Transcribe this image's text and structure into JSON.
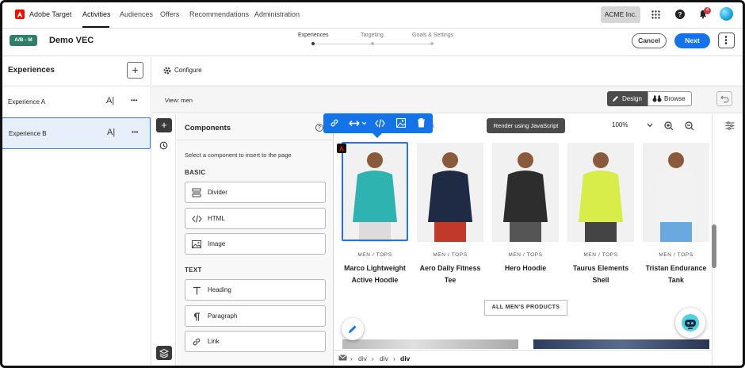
{
  "app": {
    "title": "Adobe Target"
  },
  "topnav": {
    "items": [
      "Activities",
      "Audiences",
      "Offers",
      "Recommendations",
      "Administration"
    ],
    "org": "ACME Inc.",
    "notifications": "4"
  },
  "activity": {
    "badge": "A/B - M",
    "name": "Demo VEC",
    "steps": [
      "Experiences",
      "Targeting",
      "Goals & Settings"
    ],
    "cancel": "Cancel",
    "next": "Next"
  },
  "experiences": {
    "title": "Experiences",
    "add": "+",
    "items": [
      {
        "label": "Experience A"
      },
      {
        "label": "Experience B"
      }
    ],
    "edit_glyph": "A|",
    "more_glyph": "•••"
  },
  "toolbar": {
    "configure": "Configure",
    "view": "View: men",
    "design": "Design",
    "browse": "Browse"
  },
  "components": {
    "title": "Components",
    "help": "?",
    "close": "×",
    "description": "Select a component to insert to the page",
    "basic_label": "BASIC",
    "basic": [
      {
        "label": "Divider",
        "icon": "divider-icon"
      },
      {
        "label": "HTML",
        "icon": "code-icon"
      },
      {
        "label": "Image",
        "icon": "image-icon"
      }
    ],
    "text_label": "TEXT",
    "text": [
      {
        "label": "Heading",
        "icon": "text-heading-icon"
      },
      {
        "label": "Paragraph",
        "icon": "paragraph-icon"
      },
      {
        "label": "Link",
        "icon": "link-icon"
      }
    ]
  },
  "canvas": {
    "tooltip": "Render using JavaScript",
    "zoom": "100%",
    "products": [
      {
        "category": "MEN / TOPS",
        "name_line1": "Marco Lightweight",
        "name_line2": "Active Hoodie",
        "shirt": "#2fb3b0",
        "pants": "#dcdcdc"
      },
      {
        "category": "MEN / TOPS",
        "name_line1": "Aero Daily Fitness",
        "name_line2": "Tee",
        "shirt": "#1f2a44",
        "pants": "#c0392b"
      },
      {
        "category": "MEN / TOPS",
        "name_line1": "Hero Hoodie",
        "name_line2": "",
        "shirt": "#2d2d2d",
        "pants": "#555555"
      },
      {
        "category": "MEN / TOPS",
        "name_line1": "Taurus Elements",
        "name_line2": "Shell",
        "shirt": "#d8ec4a",
        "pants": "#444444"
      },
      {
        "category": "MEN / TOPS",
        "name_line1": "Tristan Endurance",
        "name_line2": "Tank",
        "shirt": "#f2f2f2",
        "pants": "#6aa8e0"
      }
    ],
    "all_button": "ALL MEN'S PRODUCTS"
  },
  "breadcrumb": [
    "div",
    "div",
    "div"
  ],
  "colors": {
    "accent": "#1473e6",
    "brand": "#eb1000",
    "badge": "#2f7f67"
  }
}
